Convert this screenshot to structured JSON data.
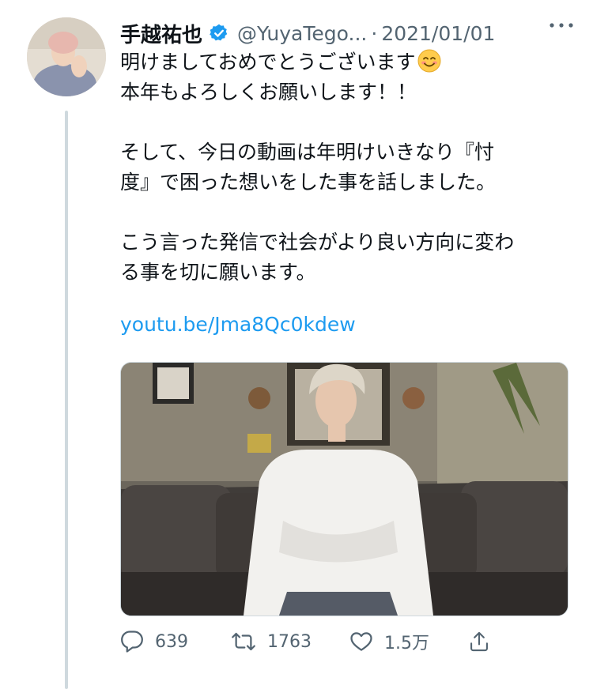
{
  "author": {
    "display_name": "手越祐也",
    "handle": "@YuyaTego...",
    "separator": "·",
    "date": "2021/01/01",
    "verified": true
  },
  "more_icon": "more-horizontal-icon",
  "tweet": {
    "line1": "明けましておめでとうございます",
    "line2": "本年もよろしくお願いします！！",
    "line3": "そして、今日の動画は年明けいきなり『忖",
    "line4": "度』で困った想いをした事を話しました。",
    "line5": "こう言った発信で社会がより良い方向に変わ",
    "line6": "る事を切に願います。",
    "link": "youtu.be/Jma8Qc0kdew"
  },
  "actions": {
    "reply_count": "639",
    "retweet_count": "1763",
    "like_count": "1.5万"
  },
  "colors": {
    "link": "#1d9bf0",
    "verified": "#1d9bf0",
    "muted": "#536471"
  }
}
